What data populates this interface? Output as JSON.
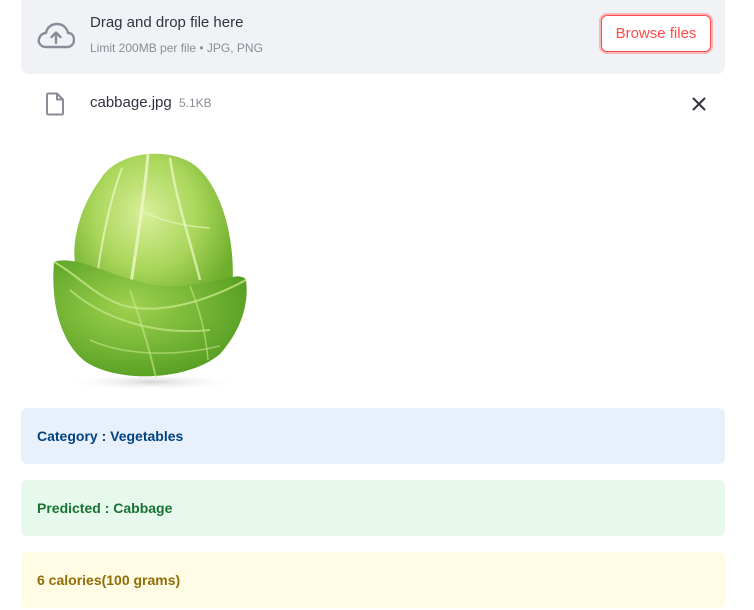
{
  "uploader": {
    "title": "Drag and drop file here",
    "limit_text": "Limit 200MB per file • JPG, PNG",
    "browse_label": "Browse files",
    "icon": "cloud-upload-icon"
  },
  "file": {
    "name": "cabbage.jpg",
    "size": "5.1KB",
    "icon": "file-icon",
    "remove_icon": "close-icon"
  },
  "results": {
    "category": "Category : Vegetables",
    "predicted": "Predicted : Cabbage",
    "calories": "6 calories(100 grams)"
  },
  "colors": {
    "accent": "#ff4b4b",
    "info_bg": "#e8f1fb",
    "success_bg": "#e7f8ec",
    "warning_bg": "#fffce6"
  }
}
